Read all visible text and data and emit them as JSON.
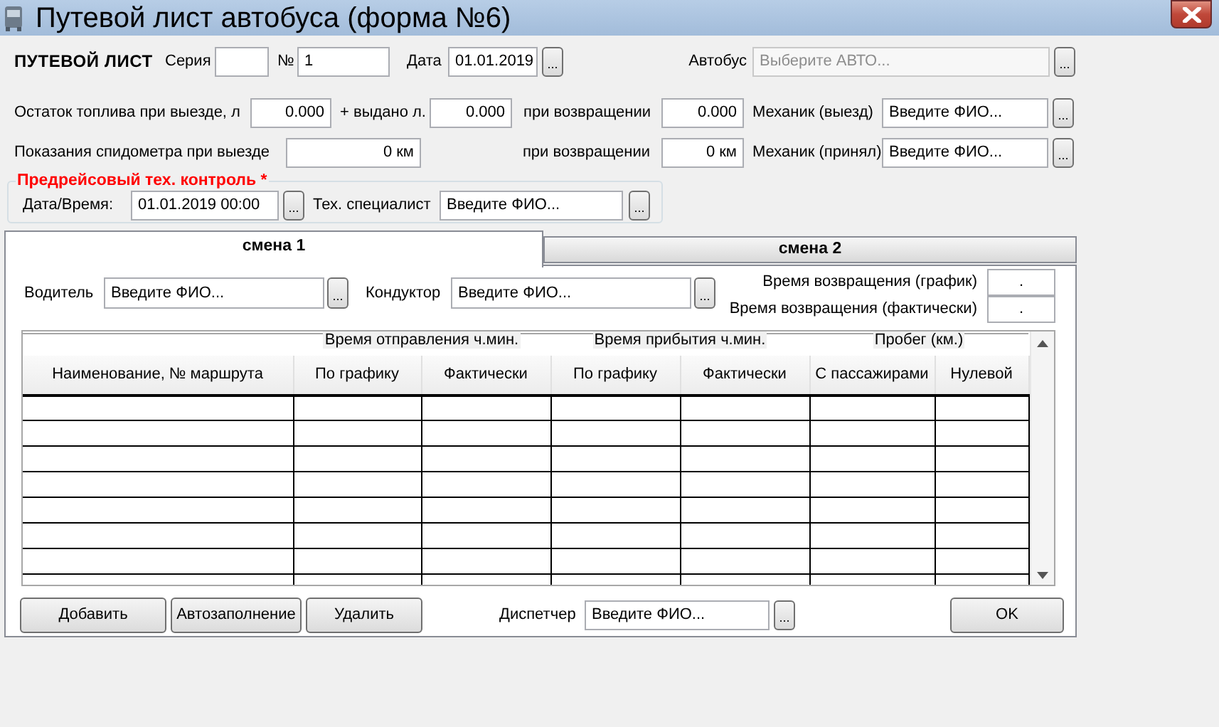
{
  "window": {
    "title": "Путевой лист автобуса (форма №6)"
  },
  "waybill": {
    "heading": "ПУТЕВОЙ ЛИСТ",
    "series": {
      "label": "Серия"
    },
    "number": {
      "label": "№",
      "value": "1"
    },
    "date": {
      "label": "Дата",
      "value": "01.01.2019",
      "button": "..."
    },
    "bus": {
      "label": "Автобус",
      "value": "Выберите АВТО...",
      "disabled": true,
      "button": "..."
    }
  },
  "fuel": {
    "departure": {
      "label": "Остаток топлива при выезде, л",
      "value": "0.000"
    },
    "issued": {
      "label": "+ выдано л.",
      "value": "0.000"
    },
    "returned": {
      "label": "при возвращении",
      "value": "0.000"
    },
    "mechanic_out": {
      "label": "Механик (выезд)",
      "value": "Введите ФИО...",
      "button": "..."
    }
  },
  "odometer": {
    "departure": {
      "label": "Показания спидометра при выезде",
      "value": "0 км"
    },
    "returned": {
      "label": "при возвращении",
      "value": "0 км"
    },
    "mechanic_in": {
      "label": "Механик (принял)",
      "value": "Введите ФИО...",
      "button": "..."
    }
  },
  "pretrip_control": {
    "title": "Предрейсовый тех. контроль *",
    "datetime": {
      "label": "Дата/Время:",
      "value": "01.01.2019 00:00",
      "button": "..."
    },
    "specialist": {
      "label": "Тех. специалист",
      "value": "Введите ФИО...",
      "button": "..."
    }
  },
  "tabs": [
    {
      "label": "смена 1",
      "selected": true
    },
    {
      "label": "смена 2",
      "selected": false
    }
  ],
  "shift": {
    "driver": {
      "label": "Водитель",
      "value": "Введите ФИО...",
      "button": "..."
    },
    "conductor": {
      "label": "Кондуктор",
      "value": "Введите ФИО...",
      "button": "..."
    },
    "return_scheduled": {
      "label": "Время возвращения (график)",
      "value": "."
    },
    "return_actual": {
      "label": "Время возвращения (фактически)",
      "value": "."
    },
    "table": {
      "columns": [
        {
          "label": "Наименование, № маршрута"
        },
        {
          "group": "Время отправления ч.мин.",
          "columns": [
            "По графику",
            "Фактически"
          ]
        },
        {
          "group": "Время прибытия ч.мин.",
          "columns": [
            "По графику",
            "Фактически"
          ]
        },
        {
          "group": "Пробег (км.)",
          "columns": [
            "С пассажирами",
            "Нулевой"
          ]
        }
      ]
    },
    "buttons": [
      "Добавить",
      "Автозаполнение",
      "Удалить"
    ],
    "dispatcher": {
      "label": "Диспетчер",
      "value": "Введите ФИО...",
      "button": "..."
    },
    "ok": "OK"
  }
}
